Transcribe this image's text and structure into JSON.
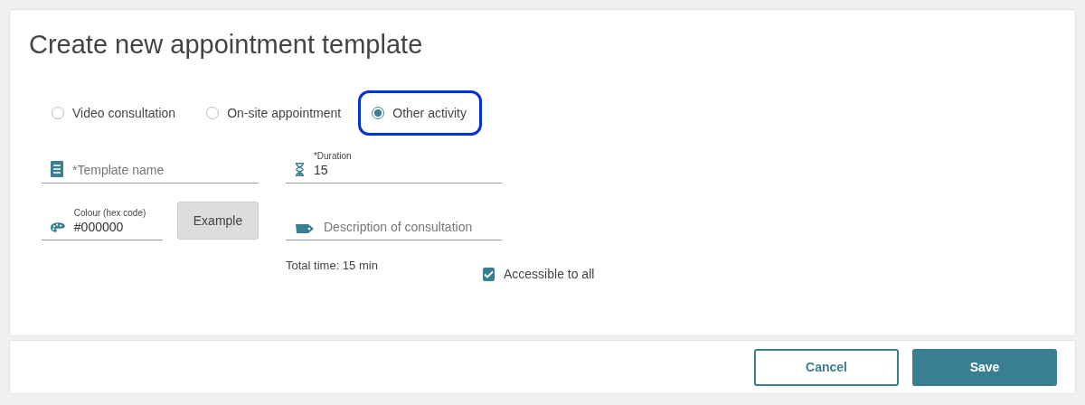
{
  "title": "Create new appointment template",
  "appointment_types": [
    {
      "label": "Video consultation",
      "selected": false,
      "focused": false
    },
    {
      "label": "On-site appointment",
      "selected": false,
      "focused": false
    },
    {
      "label": "Other activity",
      "selected": true,
      "focused": true
    }
  ],
  "template_name": {
    "placeholder": "*Template name"
  },
  "duration": {
    "label": "*Duration",
    "value": "15"
  },
  "colour": {
    "label": "Colour (hex code)",
    "value": "#000000"
  },
  "example_button": "Example",
  "description": {
    "placeholder": "Description of consultation"
  },
  "total_time": "Total time: 15 min",
  "accessible": {
    "label": "Accessible to all",
    "checked": true
  },
  "buttons": {
    "cancel": "Cancel",
    "save": "Save"
  }
}
